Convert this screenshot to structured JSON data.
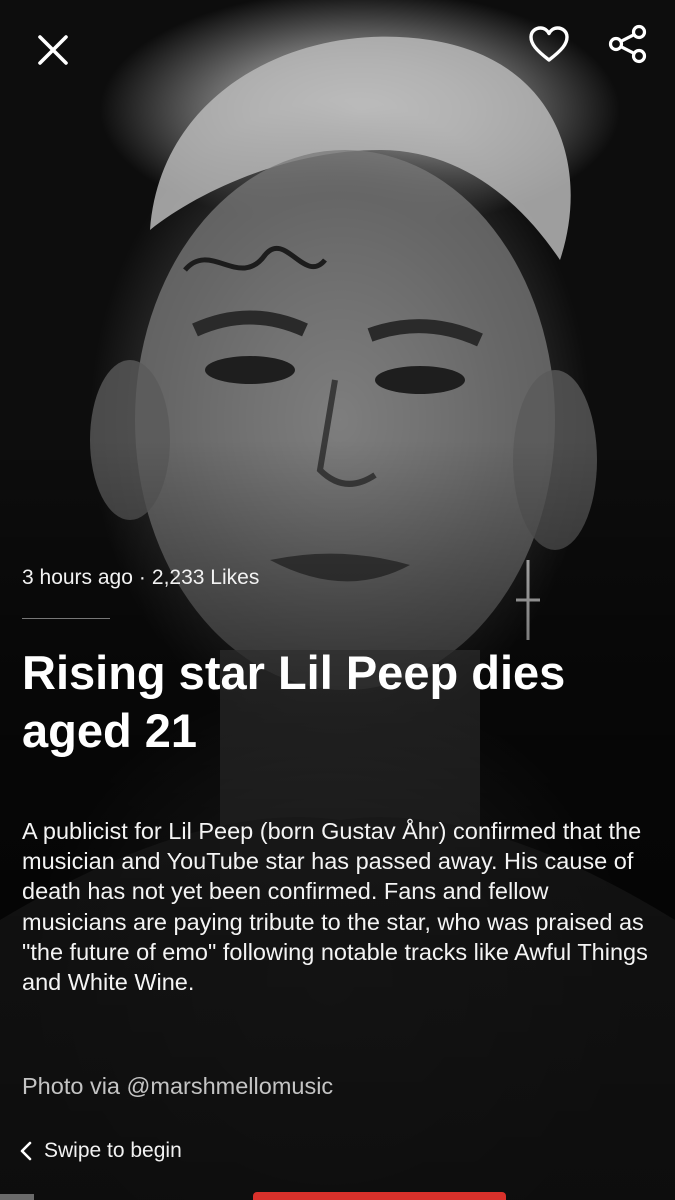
{
  "topbar": {
    "close_icon": "close-icon",
    "like_icon": "heart-icon",
    "share_icon": "share-icon"
  },
  "article": {
    "timestamp": "3 hours ago",
    "separator": "·",
    "likes": "2,233 Likes",
    "headline": "Rising star Lil Peep dies aged 21",
    "body": "A publicist for Lil Peep (born Gustav Åhr) confirmed that the musician and YouTube star has passed away. His cause of death has not yet been confirmed. Fans and fellow musicians are paying tribute to the star, who was praised as \"the future of emo\" following notable tracks like Awful Things and White Wine.",
    "photo_credit": "Photo via @marshmellomusic"
  },
  "footer": {
    "swipe_icon": "chevron-left-icon",
    "swipe_label": "Swipe to begin",
    "accent_color": "#d9312b"
  }
}
